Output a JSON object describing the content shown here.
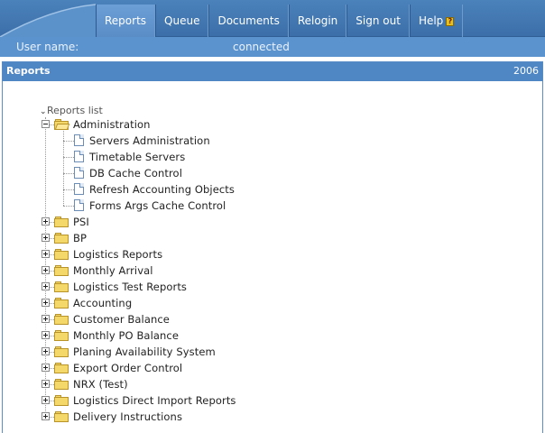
{
  "nav": {
    "tabs": [
      {
        "label": "Reports",
        "active": true
      },
      {
        "label": "Queue"
      },
      {
        "label": "Documents"
      },
      {
        "label": "Relogin"
      },
      {
        "label": "Sign out"
      },
      {
        "label": "Help"
      }
    ],
    "help_icon_glyph": "?"
  },
  "userbar": {
    "label": "User name:",
    "status": "connected"
  },
  "panel": {
    "title": "Reports",
    "year": "2006"
  },
  "tree": {
    "root_label": "Reports list",
    "expanded_folder": {
      "label": "Administration",
      "children": [
        "Servers Administration",
        "Timetable Servers",
        "DB Cache Control",
        "Refresh Accounting Objects",
        "Forms Args Cache Control"
      ]
    },
    "folders": [
      "PSI",
      "BP",
      "Logistics Reports",
      "Monthly Arrival",
      "Logistics Test Reports",
      "Accounting",
      "Customer Balance",
      "Monthly PO Balance",
      "Planing Availability System",
      "Export Order Control",
      "NRX (Test)",
      "Logistics Direct Import Reports",
      "Delivery Instructions"
    ]
  },
  "colors": {
    "nav_bg": "#4179b4",
    "tab_active": "#6395cf",
    "userbar_bg": "#5b93cf",
    "panel_header": "#4f86c4",
    "folder_yellow": "#f5d86a"
  }
}
